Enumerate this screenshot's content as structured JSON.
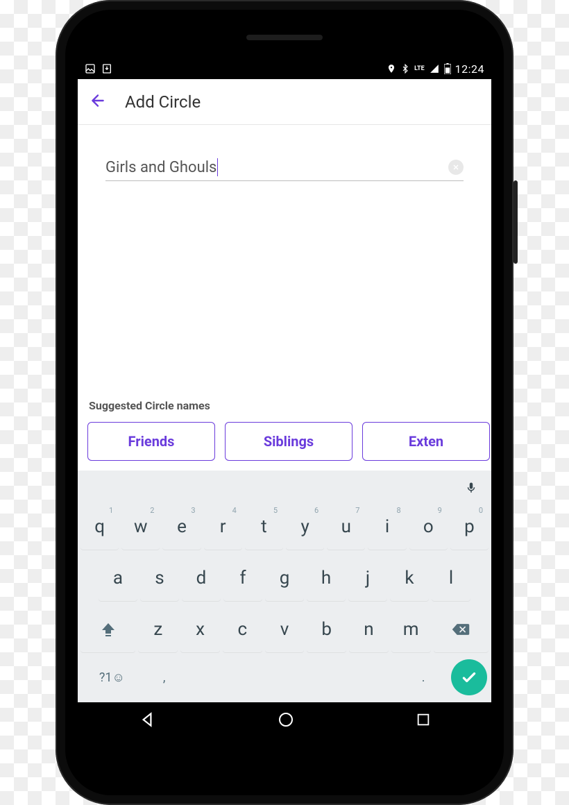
{
  "status": {
    "time": "12:24",
    "lte": "LTE"
  },
  "appbar": {
    "title": "Add Circle"
  },
  "input": {
    "value": "Girls and Ghouls"
  },
  "suggestions": {
    "label": "Suggested Circle names",
    "items": [
      "Friends",
      "Siblings",
      "Exten"
    ]
  },
  "keyboard": {
    "row1": [
      {
        "k": "q",
        "n": "1"
      },
      {
        "k": "w",
        "n": "2"
      },
      {
        "k": "e",
        "n": "3"
      },
      {
        "k": "r",
        "n": "4"
      },
      {
        "k": "t",
        "n": "5"
      },
      {
        "k": "y",
        "n": "6"
      },
      {
        "k": "u",
        "n": "7"
      },
      {
        "k": "i",
        "n": "8"
      },
      {
        "k": "o",
        "n": "9"
      },
      {
        "k": "p",
        "n": "0"
      }
    ],
    "row2": [
      "a",
      "s",
      "d",
      "f",
      "g",
      "h",
      "j",
      "k",
      "l"
    ],
    "row3": [
      "z",
      "x",
      "c",
      "v",
      "b",
      "n",
      "m"
    ],
    "sym": "?1☺",
    "comma": ",",
    "period": "."
  }
}
